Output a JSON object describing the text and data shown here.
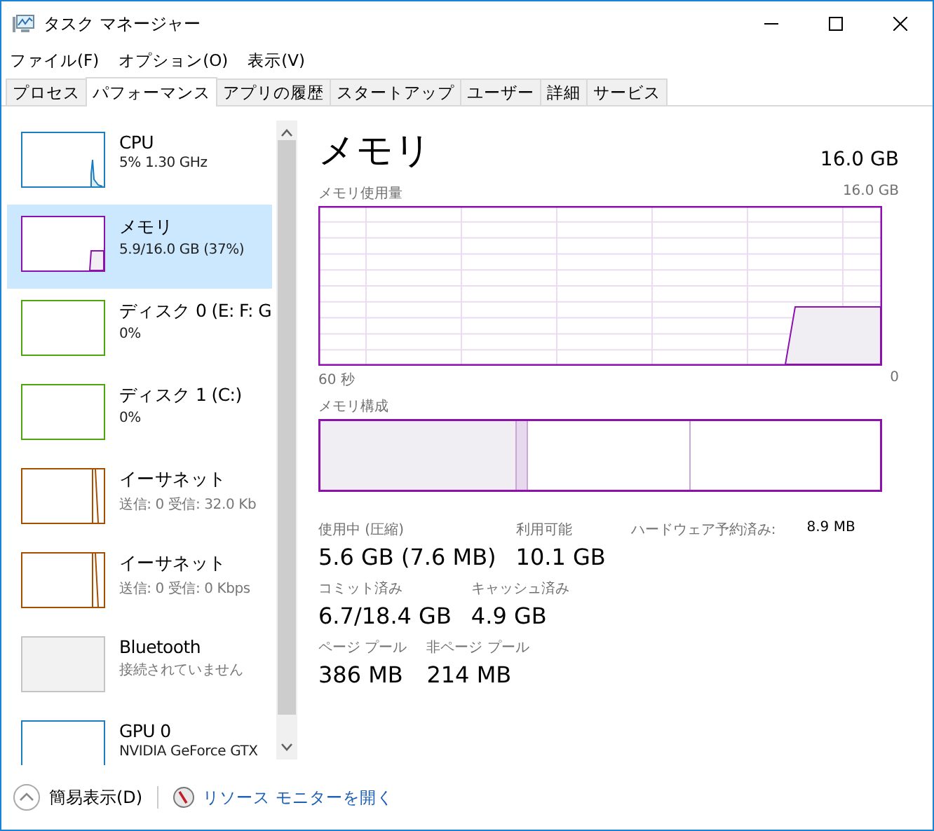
{
  "window": {
    "title": "タスク マネージャー"
  },
  "menu": [
    "ファイル(F)",
    "オプション(O)",
    "表示(V)"
  ],
  "tabs": [
    {
      "label": "プロセス",
      "selected": false
    },
    {
      "label": "パフォーマンス",
      "selected": true
    },
    {
      "label": "アプリの履歴",
      "selected": false
    },
    {
      "label": "スタートアップ",
      "selected": false
    },
    {
      "label": "ユーザー",
      "selected": false
    },
    {
      "label": "詳細",
      "selected": false
    },
    {
      "label": "サービス",
      "selected": false
    }
  ],
  "sidebar": {
    "items": [
      {
        "kind": "cpu",
        "name": "CPU",
        "detail": "5%  1.30 GHz",
        "color": "#1a7dc0",
        "selected": false
      },
      {
        "kind": "memory",
        "name": "メモリ",
        "detail": "5.9/16.0 GB (37%)",
        "color": "#8b12ae",
        "selected": true
      },
      {
        "kind": "disk",
        "name": "ディスク 0 (E: F: G",
        "detail": "0%",
        "color": "#4da60c",
        "selected": false
      },
      {
        "kind": "disk",
        "name": "ディスク 1 (C:)",
        "detail": "0%",
        "color": "#4da60c",
        "selected": false
      },
      {
        "kind": "ethernet",
        "name": "イーサネット",
        "detail": "送信: 0 受信: 32.0 Kb",
        "color": "#a74f01",
        "selected": false
      },
      {
        "kind": "ethernet",
        "name": "イーサネット",
        "detail": "送信: 0 受信: 0 Kbps",
        "color": "#a74f01",
        "selected": false
      },
      {
        "kind": "off",
        "name": "Bluetooth",
        "detail": "接続されていません",
        "color": "#c4c4c4",
        "selected": false
      },
      {
        "kind": "gpu",
        "name": "GPU 0",
        "detail": "NVIDIA GeForce GTX",
        "color": "#1a7dc0",
        "selected": false
      }
    ]
  },
  "panel": {
    "title": "メモリ",
    "total": "16.0 GB",
    "usage_label": "メモリ使用量",
    "usage_max": "16.0 GB",
    "time_start": "60 秒",
    "time_end": "0",
    "composition_label": "メモリ構成",
    "stats": [
      [
        {
          "label": "使用中 (圧縮)",
          "value": "5.6 GB (7.6 MB)"
        },
        {
          "label": "利用可能",
          "value": "10.1 GB"
        }
      ],
      [
        {
          "label": "コミット済み",
          "value": "6.7/18.4 GB"
        },
        {
          "label": "キャッシュ済み",
          "value": "4.9 GB"
        }
      ],
      [
        {
          "label": "ページ プール",
          "value": "386 MB"
        },
        {
          "label": "非ページ プール",
          "value": "214 MB"
        }
      ]
    ],
    "hardware_reserved": {
      "label": "ハードウェア予約済み:",
      "value": "8.9 MB"
    }
  },
  "footer": {
    "fewer_details": "簡易表示(D)",
    "resource_monitor": "リソース モニターを開く"
  }
}
